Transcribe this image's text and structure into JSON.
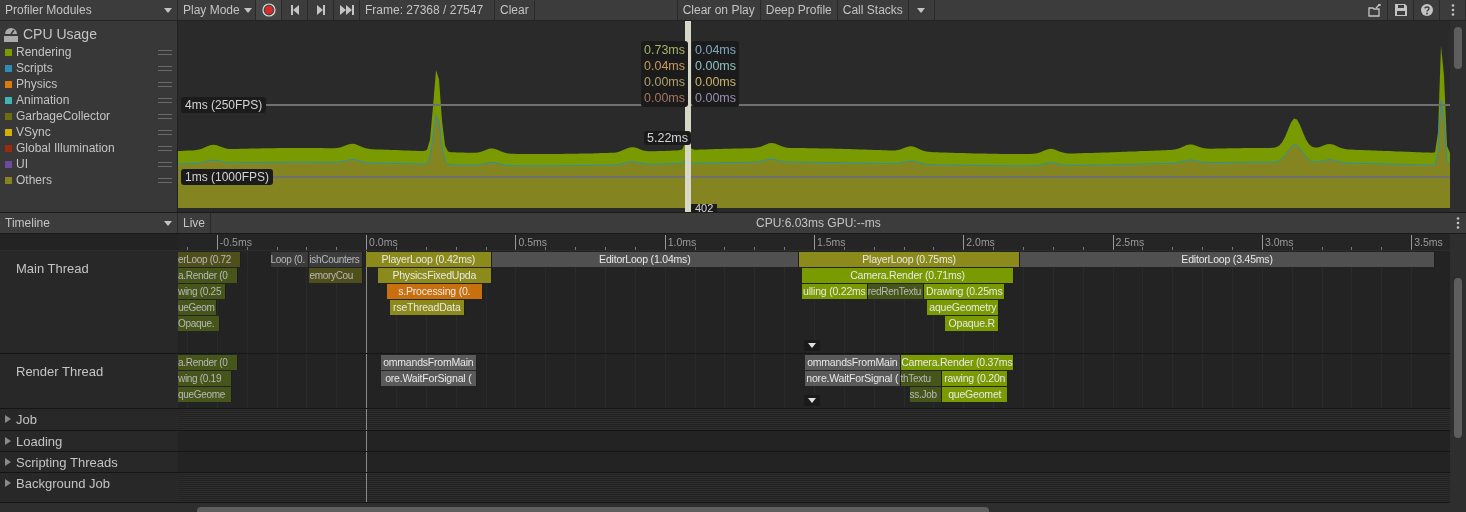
{
  "toolbar": {
    "modules": "Profiler Modules",
    "play_mode": "Play Mode",
    "frame": "Frame: 27368 / 27547",
    "clear": "Clear",
    "clear_on_play": "Clear on Play",
    "deep_profile": "Deep Profile",
    "call_stacks": "Call Stacks"
  },
  "cpu_module": {
    "title": "CPU Usage",
    "categories": [
      {
        "name": "Rendering",
        "color": "#7a9a01"
      },
      {
        "name": "Scripts",
        "color": "#2f8cb5"
      },
      {
        "name": "Physics",
        "color": "#d9790e"
      },
      {
        "name": "Animation",
        "color": "#3fb3b6"
      },
      {
        "name": "GarbageCollector",
        "color": "#6f6c0f"
      },
      {
        "name": "VSync",
        "color": "#d4b005"
      },
      {
        "name": "Global Illumination",
        "color": "#9c2a0c"
      },
      {
        "name": "UI",
        "color": "#6c4aa0"
      },
      {
        "name": "Others",
        "color": "#848421"
      }
    ],
    "guides": [
      "4ms (250FPS)",
      "1ms (1000FPS)"
    ],
    "tooltip_left": [
      {
        "value": "0.73ms",
        "color": "#a7b36a"
      },
      {
        "value": "0.04ms",
        "color": "#c99a5e"
      },
      {
        "value": "0.00ms",
        "color": "#b0a070"
      },
      {
        "value": "0.00ms",
        "color": "#a57560"
      }
    ],
    "tooltip_right": [
      {
        "value": "0.04ms",
        "color": "#7fa8c0"
      },
      {
        "value": "0.00ms",
        "color": "#8fc0c0"
      },
      {
        "value": "0.00ms",
        "color": "#c8b46a"
      },
      {
        "value": "0.00ms",
        "color": "#9a8fb0"
      }
    ],
    "total": "5.22ms",
    "frame_marker": "402"
  },
  "timeline": {
    "view": "Timeline",
    "live": "Live",
    "summary": "CPU:6.03ms  GPU:--ms",
    "ticks": [
      "-0.5ms",
      "0.0ms",
      "0.5ms",
      "1.0ms",
      "1.5ms",
      "2.0ms",
      "2.5ms",
      "3.0ms",
      "3.5ms"
    ],
    "threads": [
      {
        "name": "Main Thread",
        "kind": "thread",
        "blocks": [
          {
            "label": "erLoop (0.72",
            "color": "#4f4f1c",
            "dimmed": true
          },
          {
            "label": "Loop (0.",
            "color": "#3c3c3c",
            "dimmed": true
          },
          {
            "label": "ishCounters",
            "color": "#3c3c3c",
            "dimmed": true
          },
          {
            "label": "PlayerLoop (0.42ms)",
            "color": "#8b8a1a",
            "dimmed": false
          },
          {
            "label": "EditorLoop (1.04ms)",
            "color": "#505050",
            "dimmed": false
          },
          {
            "label": "PlayerLoop (0.75ms)",
            "color": "#8b8a1a",
            "dimmed": false
          },
          {
            "label": "EditorLoop (3.45ms)",
            "color": "#505050",
            "dimmed": false
          },
          {
            "label": "a.Render (0",
            "color": "#46551a",
            "dimmed": true
          },
          {
            "label": "emoryCou",
            "color": "#4f4f1c",
            "dimmed": true
          },
          {
            "label": "PhysicsFixedUpda",
            "color": "#8b8a1a",
            "dimmed": false
          },
          {
            "label": "Camera.Render (0.71ms)",
            "color": "#7a9a01",
            "dimmed": false
          },
          {
            "label": "wing (0.25",
            "color": "#46551a",
            "dimmed": true
          },
          {
            "label": "s.Processing (0.",
            "color": "#c8700e",
            "dimmed": false
          },
          {
            "label": "ulling (0.22ms",
            "color": "#7a9a01",
            "dimmed": false
          },
          {
            "label": "redRenTextu",
            "color": "#46551a",
            "dimmed": true
          },
          {
            "label": "Drawing (0.25ms",
            "color": "#7a9a01",
            "dimmed": false
          },
          {
            "label": "ueGeom",
            "color": "#46551a",
            "dimmed": true
          },
          {
            "label": "rseThreadData",
            "color": "#8b8a1a",
            "dimmed": false
          },
          {
            "label": "aqueGeometry",
            "color": "#7a9a01",
            "dimmed": false
          },
          {
            "label": "Opaque.",
            "color": "#46551a",
            "dimmed": true
          },
          {
            "label": "Opaque.R",
            "color": "#7a9a01",
            "dimmed": false
          }
        ]
      },
      {
        "name": "Render Thread",
        "kind": "thread",
        "blocks": [
          {
            "label": "a.Render (0",
            "color": "#46551a",
            "dimmed": true
          },
          {
            "label": "ommandsFromMain",
            "color": "#5a5a5a",
            "dimmed": false
          },
          {
            "label": "ommandsFromMain",
            "color": "#5a5a5a",
            "dimmed": false
          },
          {
            "label": "Camera.Render (0.37ms",
            "color": "#7a9a01",
            "dimmed": false
          },
          {
            "label": "wing (0.19",
            "color": "#46551a",
            "dimmed": true
          },
          {
            "label": "ore.WaitForSignal (",
            "color": "#5a5a5a",
            "dimmed": false
          },
          {
            "label": "nore.WaitForSignal (",
            "color": "#5a5a5a",
            "dimmed": false
          },
          {
            "label": "thTextu",
            "color": "#46551a",
            "dimmed": true
          },
          {
            "label": "rawing (0.20n",
            "color": "#7a9a01",
            "dimmed": false
          },
          {
            "label": "queGeome",
            "color": "#46551a",
            "dimmed": true
          },
          {
            "label": "ss.Job",
            "color": "#46551a",
            "dimmed": true
          },
          {
            "label": "queGeomet",
            "color": "#7a9a01",
            "dimmed": false
          }
        ]
      },
      {
        "name": "Job",
        "kind": "group",
        "expanded": false
      },
      {
        "name": "Loading",
        "kind": "group",
        "expanded": false
      },
      {
        "name": "Scripting Threads",
        "kind": "group",
        "expanded": false
      },
      {
        "name": "Background Job",
        "kind": "group",
        "expanded": false
      }
    ]
  }
}
